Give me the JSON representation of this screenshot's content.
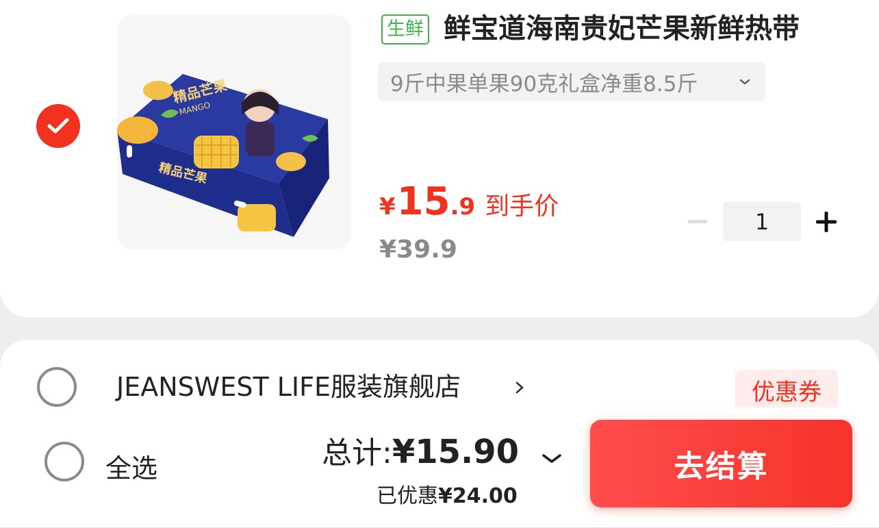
{
  "product": {
    "selected": true,
    "tag": "生鲜",
    "title": "鲜宝道海南贵妃芒果新鲜热带",
    "spec": "9斤中果单果90克礼盒净重8.5斤",
    "price": {
      "currency": "¥",
      "integer": "15",
      "decimal": ".9",
      "tag": "到手价",
      "original": "¥39.9"
    },
    "quantity": "1",
    "image_alt_icon": "mango-gift-box-image",
    "box_text_cn": "精品芒果",
    "box_text_en": "MANGO"
  },
  "store": {
    "name": "JEANSWEST LIFE服装旗舰店",
    "coupon_label": "优惠券",
    "selected": false
  },
  "bottom_bar": {
    "select_all_label": "全选",
    "total_label": "总计:",
    "total_value": "¥15.90",
    "discount_label": "已优惠",
    "discount_value": "¥24.00",
    "checkout_label": "去结算"
  },
  "colors": {
    "accent": "#f0321e",
    "fresh_tag": "#3bb54a",
    "muted_text": "#8a8a8a",
    "page_bg": "#eeeeee"
  }
}
